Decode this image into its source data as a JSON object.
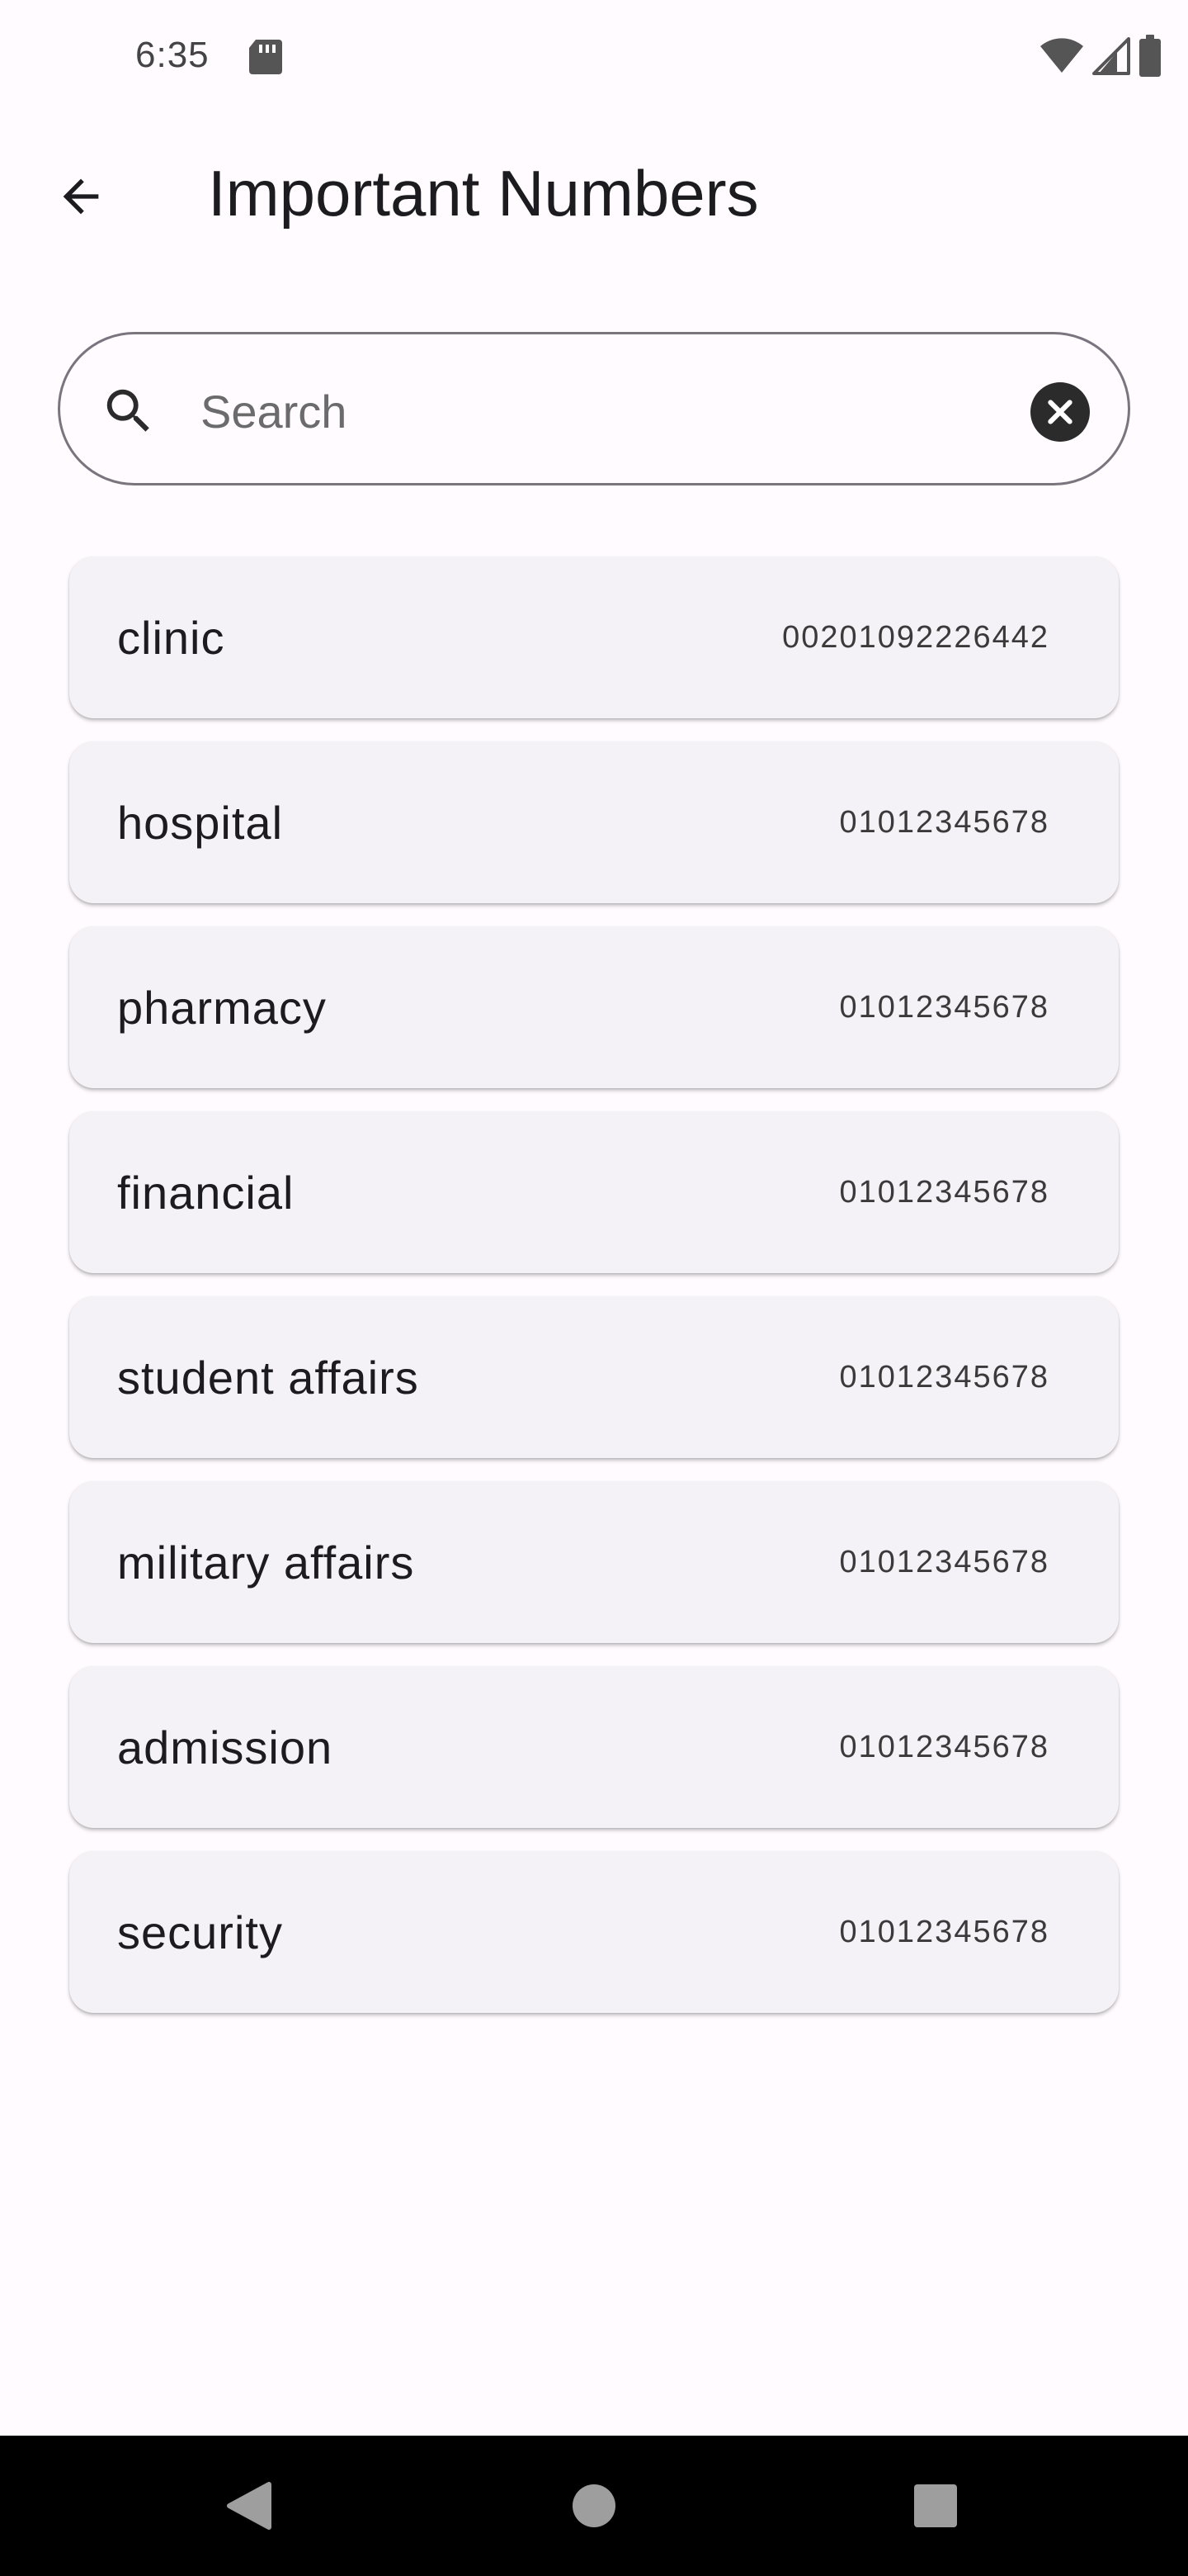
{
  "status_bar": {
    "time": "6:35",
    "icons": [
      "sd-card-icon",
      "wifi-icon",
      "signal-icon",
      "battery-icon"
    ]
  },
  "app_bar": {
    "back_icon": "arrow-back-icon",
    "title": "Important Numbers"
  },
  "search": {
    "placeholder": "Search",
    "value": "",
    "icon": "search-icon",
    "clear_icon": "clear-icon"
  },
  "contacts": [
    {
      "name": "clinic",
      "number": "00201092226442"
    },
    {
      "name": "hospital",
      "number": "01012345678"
    },
    {
      "name": "pharmacy",
      "number": "01012345678"
    },
    {
      "name": "financial",
      "number": "01012345678"
    },
    {
      "name": "student affairs",
      "number": "01012345678"
    },
    {
      "name": "military affairs",
      "number": "01012345678"
    },
    {
      "name": "admission",
      "number": "01012345678"
    },
    {
      "name": "security",
      "number": "01012345678"
    }
  ],
  "nav_bar": {
    "buttons": [
      "back-nav-icon",
      "home-nav-icon",
      "recents-nav-icon"
    ]
  },
  "colors": {
    "background": "#fffbff",
    "card": "#f4f1f7",
    "outline": "#79747e",
    "text": "#1c1b1f",
    "nav_bar": "#000000"
  }
}
